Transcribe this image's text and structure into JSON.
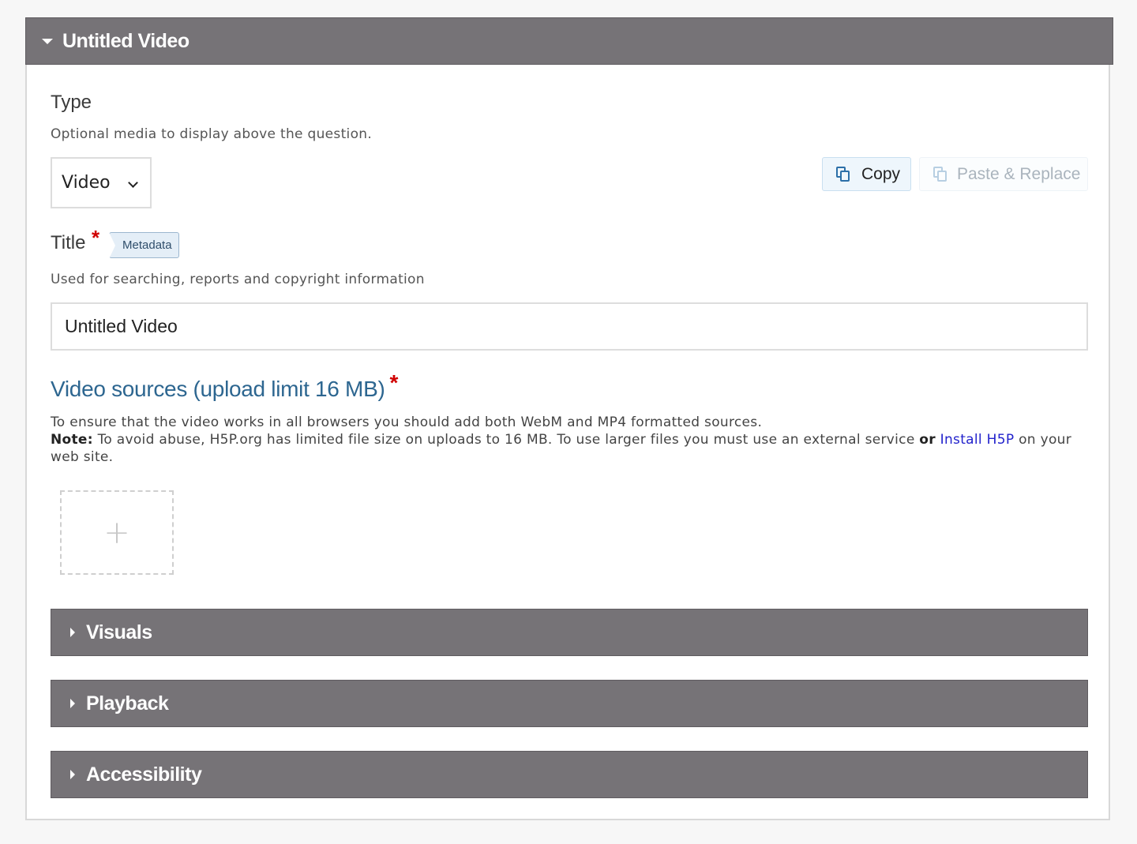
{
  "header": {
    "title": "Untitled Video"
  },
  "type_field": {
    "label": "Type",
    "description": "Optional media to display above the question.",
    "selected": "Video"
  },
  "actions": {
    "copy_label": "Copy",
    "paste_label": "Paste & Replace"
  },
  "title_field": {
    "label": "Title",
    "required_mark": "*",
    "metadata_label": "Metadata",
    "description": "Used for searching, reports and copyright information",
    "value": "Untitled Video"
  },
  "video_sources": {
    "heading": "Video sources (upload limit 16 MB)",
    "required_mark": "*",
    "line1": "To ensure that the video works in all browsers you should add both WebM and MP4 formatted sources.",
    "note_label": "Note:",
    "note_text": " To avoid abuse, H5P.org has limited file size on uploads to 16 MB. To use larger files you must use an external service ",
    "or_text": "or",
    "link_text": "Install H5P",
    "tail_text": " on your web site.",
    "add_symbol": "+"
  },
  "groups": [
    {
      "title": "Visuals"
    },
    {
      "title": "Playback"
    },
    {
      "title": "Accessibility"
    }
  ],
  "colors": {
    "header_bg": "#767377",
    "heading_blue": "#2d6690",
    "required_red": "#d00000",
    "link_blue": "#2222cc"
  }
}
